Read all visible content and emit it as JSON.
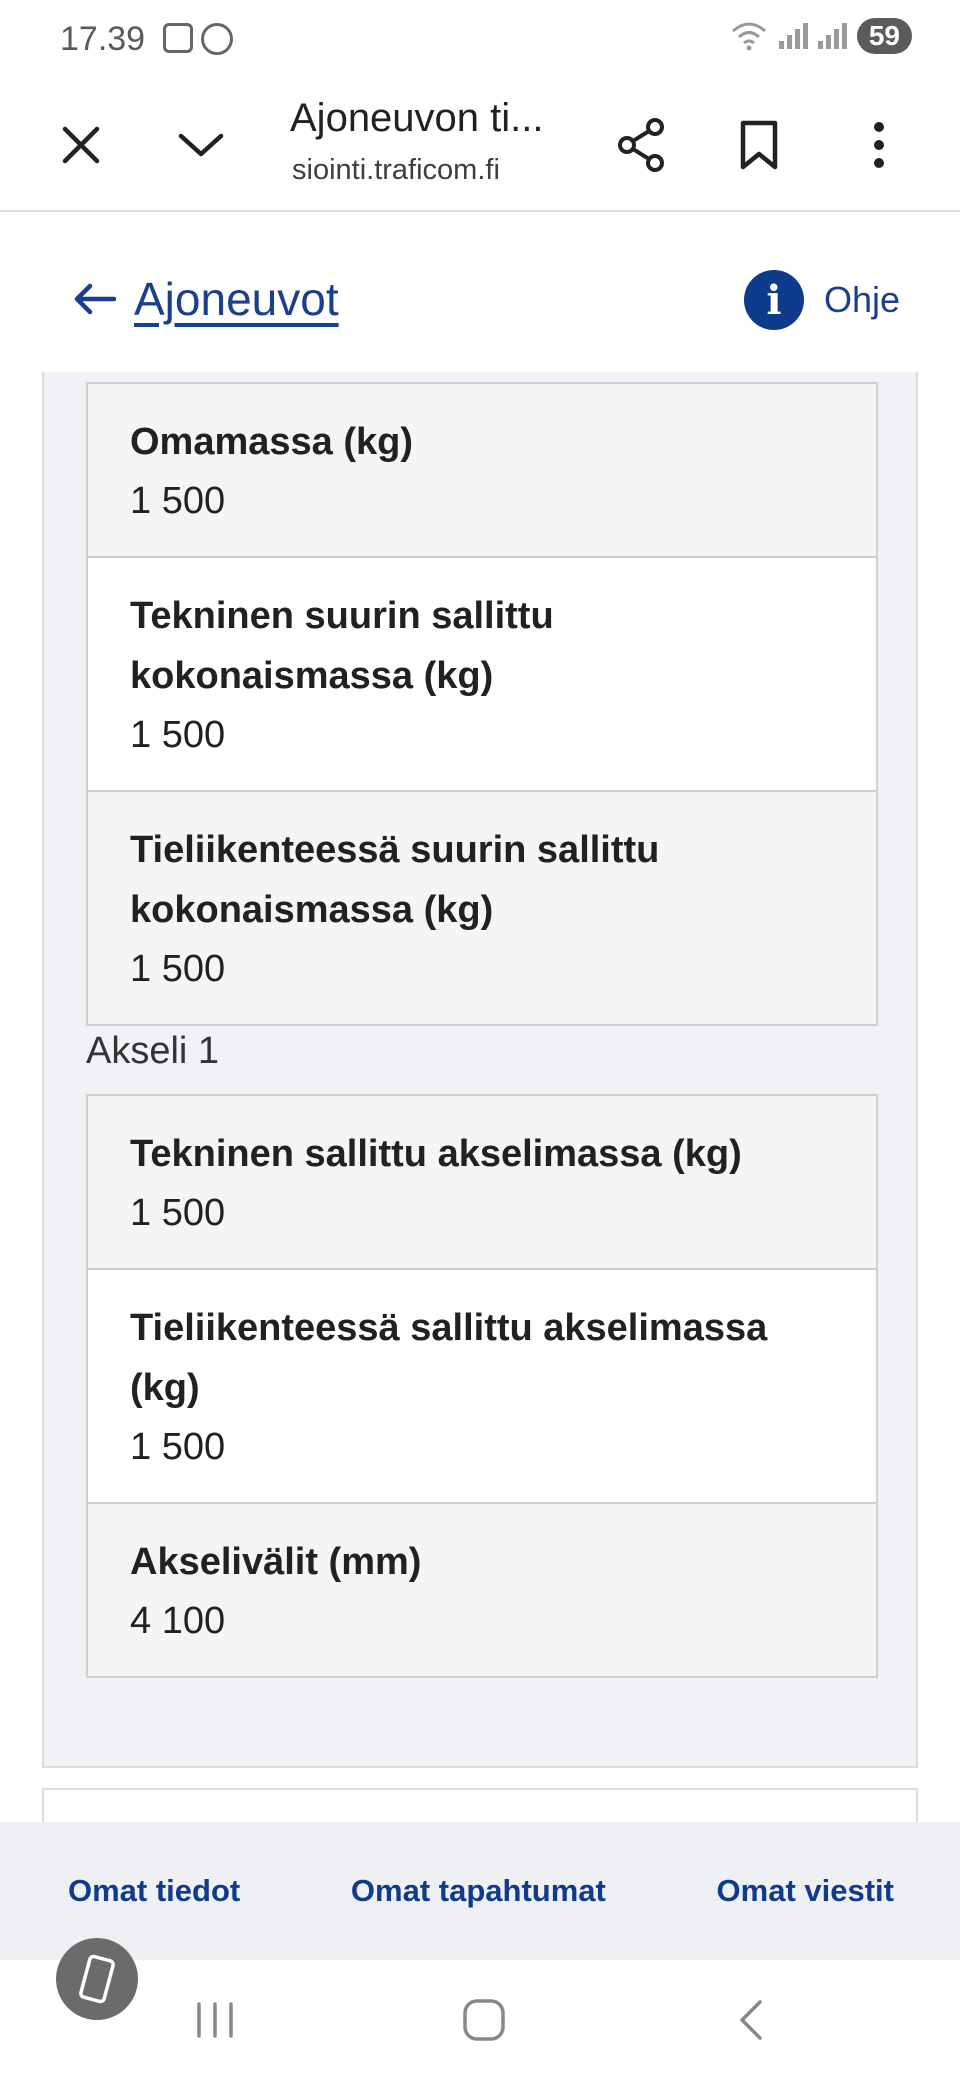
{
  "status_bar": {
    "time": "17.39",
    "battery": "59"
  },
  "browser": {
    "title": "Ajoneuvon ti...",
    "url": "siointi.traficom.fi"
  },
  "header": {
    "back_label": "Ajoneuvot",
    "help_label": "Ohje"
  },
  "mass_table": [
    {
      "label": "Omamassa (kg)",
      "value": "1 500"
    },
    {
      "label": "Tekninen suurin sallittu kokonaismassa (kg)",
      "value": "1 500"
    },
    {
      "label": "Tieliikenteessä suurin sallittu kokonaismassa (kg)",
      "value": "1 500"
    }
  ],
  "axle_section": {
    "title": "Akseli 1"
  },
  "axle_table": [
    {
      "label": "Tekninen sallittu akselimassa (kg)",
      "value": "1 500"
    },
    {
      "label": "Tieliikenteessä sallittu akselimassa (kg)",
      "value": "1 500"
    },
    {
      "label": "Akselivälit (mm)",
      "value": "4 100"
    }
  ],
  "bottom_nav": {
    "own_info": "Omat tiedot",
    "own_events": "Omat tapahtumat",
    "own_messages": "Omat viestit"
  }
}
